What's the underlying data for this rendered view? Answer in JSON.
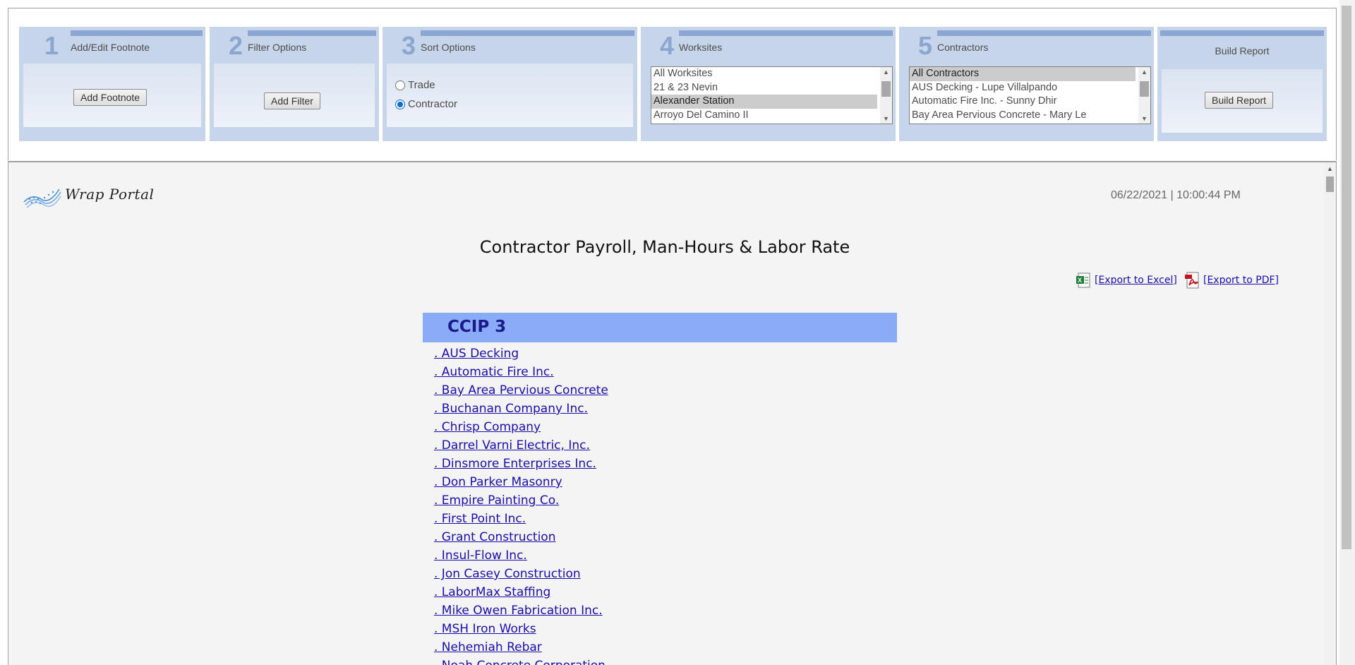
{
  "steps": [
    {
      "number": "1",
      "title": "Add/Edit Footnote",
      "button": "Add Footnote"
    },
    {
      "number": "2",
      "title": "Filter Options",
      "button": "Add Filter"
    },
    {
      "number": "3",
      "title": "Sort Options",
      "radios": [
        {
          "label": "Trade",
          "checked": false
        },
        {
          "label": "Contractor",
          "checked": true
        }
      ]
    },
    {
      "number": "4",
      "title": "Worksites",
      "options": [
        "All Worksites",
        "21 & 23 Nevin",
        "Alexander Station",
        "Arroyo Del Camino II"
      ],
      "selected": "Alexander Station"
    },
    {
      "number": "5",
      "title": "Contractors",
      "options": [
        "All Contractors",
        "AUS Decking - Lupe Villalpando",
        "Automatic Fire Inc. - Sunny Dhir",
        "Bay Area Pervious Concrete - Mary Le"
      ],
      "selected": "All Contractors"
    },
    {
      "title": "Build Report",
      "button": "Build Report"
    }
  ],
  "report": {
    "logo_text": "Wrap Portal",
    "timestamp": "06/22/2021 | 10:00:44 PM",
    "title": "Contractor Payroll, Man-Hours & Labor Rate",
    "export_excel": "[Export to Excel]",
    "export_pdf": "[Export to PDF]",
    "group": "CCIP 3",
    "contractors": [
      ". AUS Decking",
      ". Automatic Fire Inc.",
      ". Bay Area Pervious Concrete",
      ". Buchanan Company Inc.",
      ". Chrisp Company",
      ". Darrel Varni Electric, Inc.",
      ". Dinsmore Enterprises Inc.",
      ". Don Parker Masonry",
      ". Empire Painting Co.",
      ". First Point Inc.",
      ". Grant Construction",
      ". Insul-Flow Inc.",
      ". Jon Casey Construction",
      ". LaborMax Staffing",
      ". Mike Owen Fabrication Inc.",
      ". MSH Iron Works",
      ". Nehemiah Rebar",
      ". Noah Concrete Corporation"
    ]
  },
  "colors": {
    "panel_bg": "#c6d5e9",
    "panel_accent": "#8aa6d1",
    "group_header_bg": "#8aabf7",
    "group_header_text": "#1a1a8c",
    "link": "#1a0dab"
  }
}
